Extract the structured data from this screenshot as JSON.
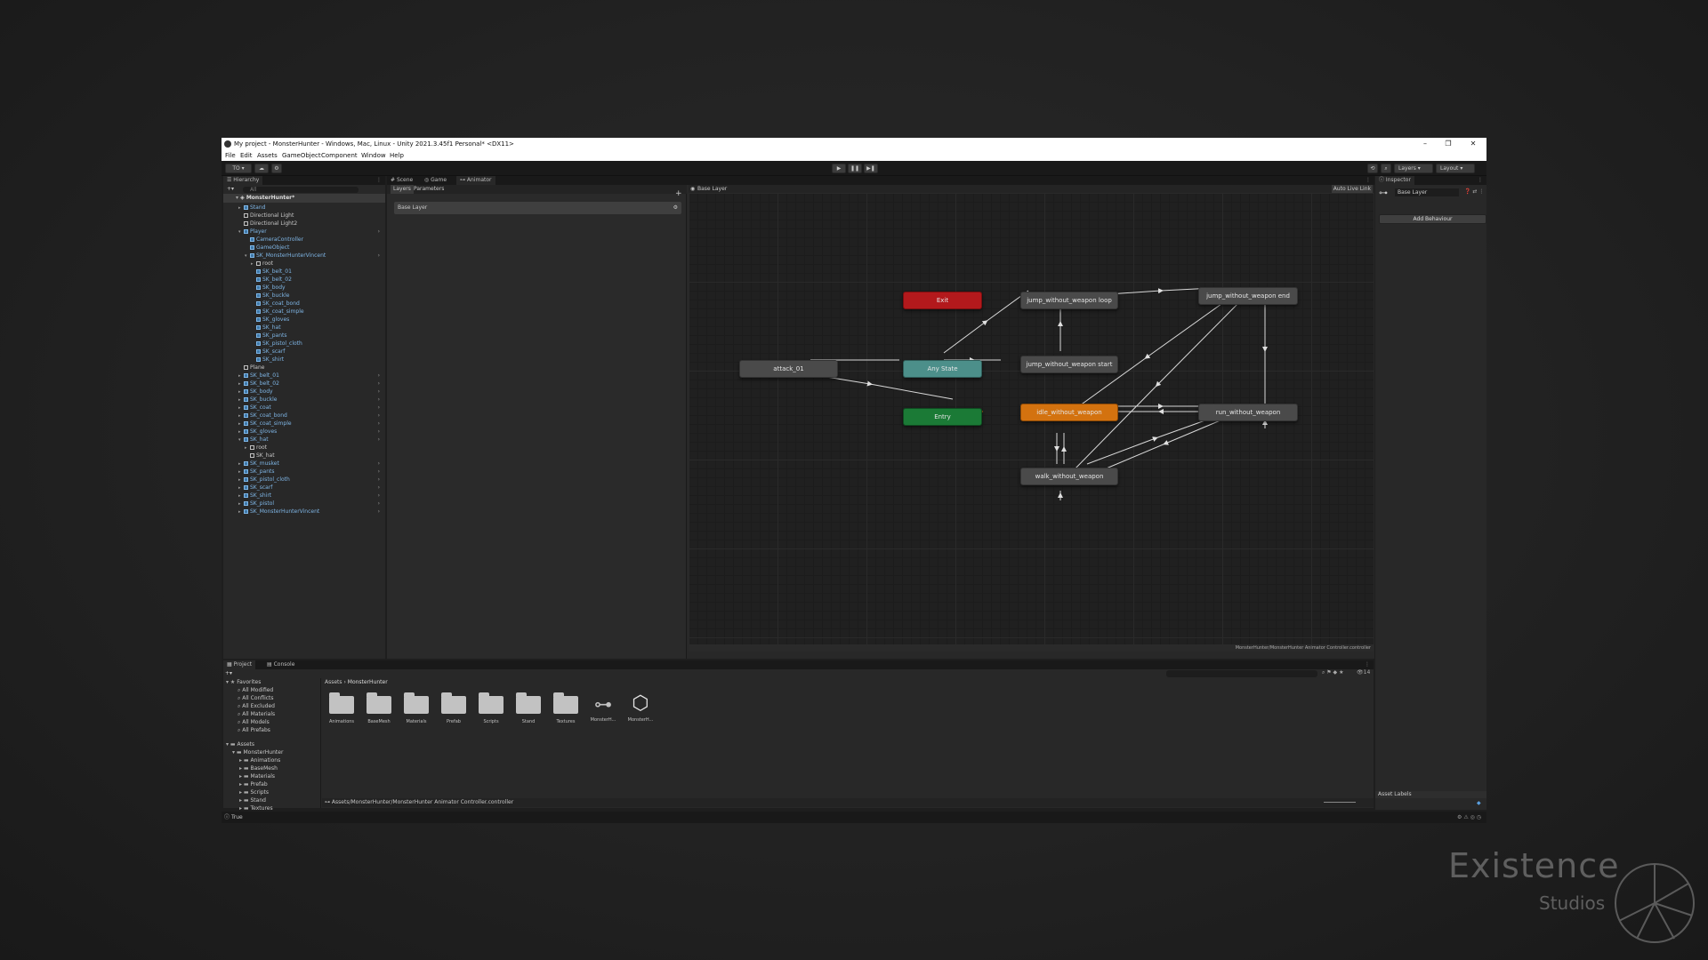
{
  "window": {
    "title": "My project - MonsterHunter - Windows, Mac, Linux - Unity 2021.3.45f1 Personal* <DX11>",
    "controls": [
      "–",
      "❐",
      "✕"
    ]
  },
  "menu": [
    "File",
    "Edit",
    "Assets",
    "GameObject",
    "Component",
    "Window",
    "Help"
  ],
  "toolbar": {
    "account": "TO",
    "layers_label": "Layers",
    "layout_label": "Layout"
  },
  "hierarchy": {
    "tab": "Hierarchy",
    "search_placeholder": "All",
    "scene": "MonsterHunter*",
    "rows": [
      {
        "label": "Stand",
        "blue": true
      },
      {
        "label": "Directional Light",
        "blue": false
      },
      {
        "label": "Directional Light2",
        "blue": false
      },
      {
        "label": "Player",
        "blue": true
      },
      {
        "label": "CameraController",
        "blue": true
      },
      {
        "label": "GameObject",
        "blue": true
      },
      {
        "label": "SK_MonsterHunterVincent",
        "blue": true
      },
      {
        "label": "root",
        "blue": false
      },
      {
        "label": "SK_belt_01",
        "blue": true
      },
      {
        "label": "SK_belt_02",
        "blue": true
      },
      {
        "label": "SK_body",
        "blue": true
      },
      {
        "label": "SK_buckle",
        "blue": true
      },
      {
        "label": "SK_coat_bond",
        "blue": true
      },
      {
        "label": "SK_coat_simple",
        "blue": true
      },
      {
        "label": "SK_gloves",
        "blue": true
      },
      {
        "label": "SK_hat",
        "blue": true
      },
      {
        "label": "SK_pants",
        "blue": true
      },
      {
        "label": "SK_pistol_cloth",
        "blue": true
      },
      {
        "label": "SK_scarf",
        "blue": true
      },
      {
        "label": "SK_shirt",
        "blue": true
      },
      {
        "label": "Plane",
        "blue": false
      },
      {
        "label": "SK_belt_01",
        "blue": true
      },
      {
        "label": "SK_belt_02",
        "blue": true
      },
      {
        "label": "SK_body",
        "blue": true
      },
      {
        "label": "SK_buckle",
        "blue": true
      },
      {
        "label": "SK_coat",
        "blue": true
      },
      {
        "label": "SK_coat_bond",
        "blue": true
      },
      {
        "label": "SK_coat_simple",
        "blue": true
      },
      {
        "label": "SK_gloves",
        "blue": true
      },
      {
        "label": "SK_hat",
        "blue": true
      },
      {
        "label": "root",
        "blue": false
      },
      {
        "label": "SK_hat",
        "blue": false
      },
      {
        "label": "SK_musket",
        "blue": true
      },
      {
        "label": "SK_pants",
        "blue": true
      },
      {
        "label": "SK_pistol_cloth",
        "blue": true
      },
      {
        "label": "SK_scarf",
        "blue": true
      },
      {
        "label": "SK_shirt",
        "blue": true
      },
      {
        "label": "SK_pistol",
        "blue": true
      },
      {
        "label": "SK_MonsterHunterVincent",
        "blue": true
      }
    ]
  },
  "center_tabs": [
    "Scene",
    "Game",
    "Animator"
  ],
  "animator": {
    "subtabs": [
      "Layers",
      "Parameters"
    ],
    "layer_name": "Base Layer",
    "breadcrumb": "Base Layer",
    "auto_live_link": "Auto Live Link",
    "controller_path": "MonsterHunter/MonsterHunter Animator Controller.controller",
    "states": {
      "exit": "Exit",
      "any_state": "Any State",
      "entry": "Entry",
      "attack": "attack_01",
      "idle": "idle_without_weapon",
      "jump_loop": "jump_without_weapon loop",
      "jump_start": "jump_without_weapon start",
      "jump_end": "jump_without_weapon end",
      "run": "run_without_weapon",
      "walk": "walk_without_weapon"
    },
    "colors": {
      "exit": "#b3191c",
      "any_state": "#4c8f8a",
      "entry": "#1b7a36",
      "idle": "#d3720f",
      "default": "#4a4a4a"
    }
  },
  "inspector": {
    "tab": "Inspector",
    "layer_name": "Base Layer",
    "add_behaviour": "Add Behaviour",
    "asset_labels": "Asset Labels"
  },
  "project": {
    "tabs": [
      "Project",
      "Console"
    ],
    "favorites_label": "Favorites",
    "favorites": [
      "All Modified",
      "All Conflicts",
      "All Excluded",
      "All Materials",
      "All Models",
      "All Prefabs"
    ],
    "assets_label": "Assets",
    "tree": [
      "MonsterHunter",
      "Animations",
      "BaseMesh",
      "Materials",
      "Prefab",
      "Scripts",
      "Stand",
      "Textures"
    ],
    "breadcrumb_root": "Assets",
    "breadcrumb_current": "MonsterHunter",
    "items": [
      "Animations",
      "BaseMesh",
      "Materials",
      "Prefab",
      "Scripts",
      "Stand",
      "Textures",
      "MonsterH...",
      "MonsterH..."
    ],
    "count": "14",
    "status_path": "Assets/MonsterHunter/MonsterHunter Animator Controller.controller"
  },
  "statusbar": {
    "message": "True"
  },
  "watermark": {
    "line1": "Existence",
    "line2": "Studios"
  }
}
